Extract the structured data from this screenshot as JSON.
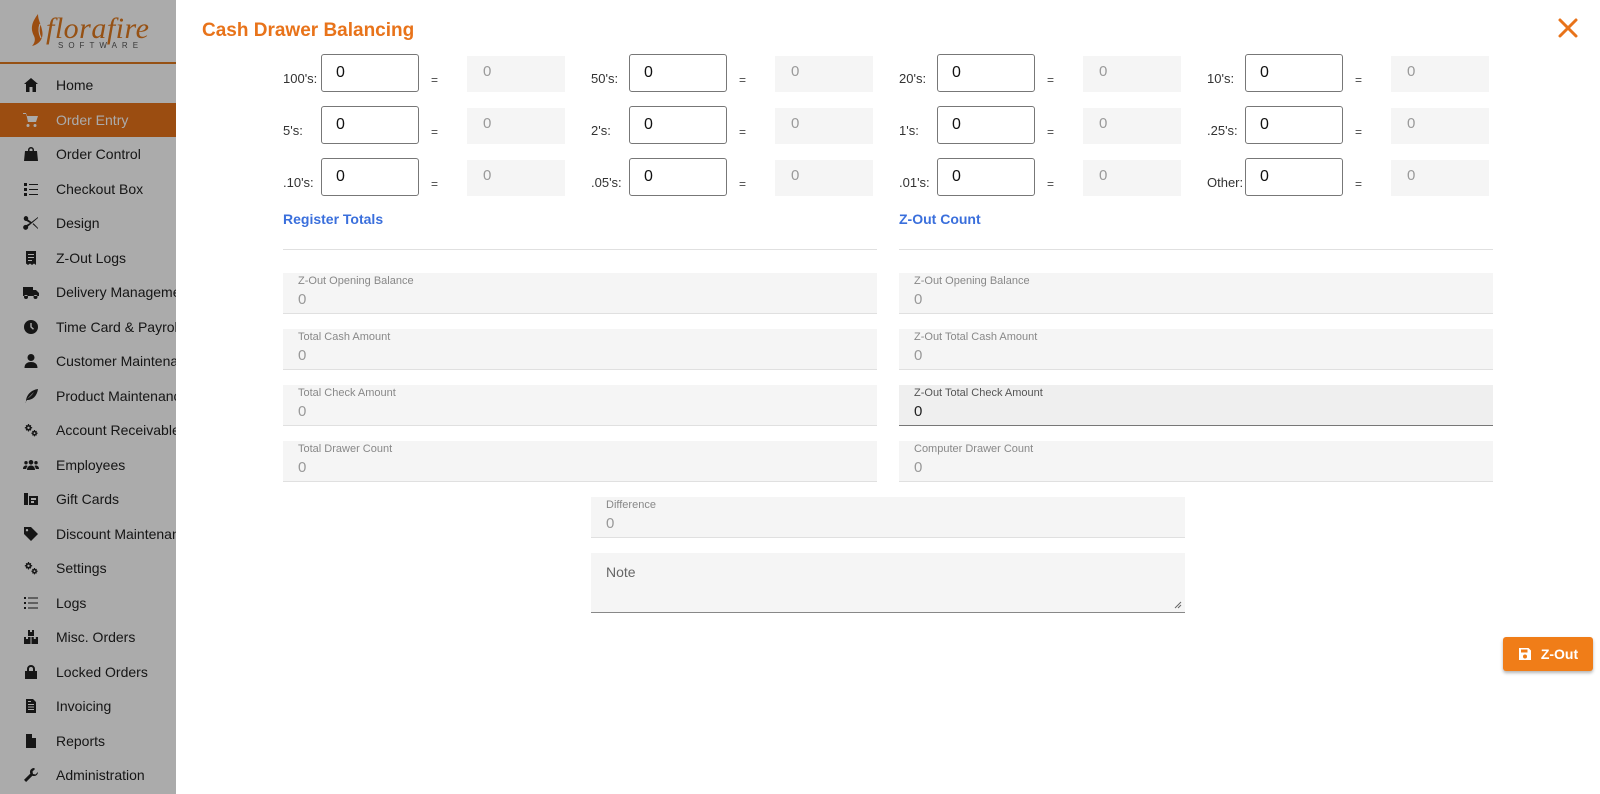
{
  "app": {
    "logo_text": "florafire",
    "logo_sub": "SOFTWARE",
    "brand_color": "#e8731a"
  },
  "sidebar": {
    "items": [
      {
        "label": "Home",
        "icon": "home-icon"
      },
      {
        "label": "Order Entry",
        "icon": "cart-icon",
        "active": true
      },
      {
        "label": "Order Control",
        "icon": "bag-icon"
      },
      {
        "label": "Checkout Box",
        "icon": "checklist-icon"
      },
      {
        "label": "Design",
        "icon": "scissors-icon"
      },
      {
        "label": "Z-Out Logs",
        "icon": "receipt-icon"
      },
      {
        "label": "Delivery Management",
        "icon": "truck-icon"
      },
      {
        "label": "Time Card & Payroll",
        "icon": "clock-icon"
      },
      {
        "label": "Customer Maintenance",
        "icon": "user-icon"
      },
      {
        "label": "Product Maintenance",
        "icon": "leaf-icon"
      },
      {
        "label": "Account Receivable",
        "icon": "gears-icon"
      },
      {
        "label": "Employees",
        "icon": "users-icon"
      },
      {
        "label": "Gift Cards",
        "icon": "gift-card-icon"
      },
      {
        "label": "Discount Maintenance",
        "icon": "tag-icon"
      },
      {
        "label": "Settings",
        "icon": "gears-icon"
      },
      {
        "label": "Logs",
        "icon": "list-icon"
      },
      {
        "label": "Misc. Orders",
        "icon": "boxes-icon"
      },
      {
        "label": "Locked Orders",
        "icon": "lock-icon"
      },
      {
        "label": "Invoicing",
        "icon": "invoice-icon"
      },
      {
        "label": "Reports",
        "icon": "file-icon"
      },
      {
        "label": "Administration",
        "icon": "wrench-icon"
      }
    ]
  },
  "modal": {
    "title": "Cash Drawer Balancing",
    "denominations": [
      {
        "label": "100's:",
        "value": "0",
        "result": "0"
      },
      {
        "label": "50's:",
        "value": "0",
        "result": "0"
      },
      {
        "label": "20's:",
        "value": "0",
        "result": "0"
      },
      {
        "label": "10's:",
        "value": "0",
        "result": "0"
      },
      {
        "label": "5's:",
        "value": "0",
        "result": "0"
      },
      {
        "label": "2's:",
        "value": "0",
        "result": "0"
      },
      {
        "label": "1's:",
        "value": "0",
        "result": "0"
      },
      {
        "label": ".25's:",
        "value": "0",
        "result": "0"
      },
      {
        "label": ".10's:",
        "value": "0",
        "result": "0"
      },
      {
        "label": ".05's:",
        "value": "0",
        "result": "0"
      },
      {
        "label": ".01's:",
        "value": "0",
        "result": "0"
      },
      {
        "label": "Other:",
        "value": "0",
        "result": "0"
      }
    ],
    "equals": "=",
    "register_totals": {
      "title": "Register Totals",
      "fields": [
        {
          "label": "Z-Out Opening Balance",
          "value": "0"
        },
        {
          "label": "Total Cash Amount",
          "value": "0"
        },
        {
          "label": "Total Check Amount",
          "value": "0"
        },
        {
          "label": "Total Drawer Count",
          "value": "0"
        }
      ]
    },
    "zout_count": {
      "title": "Z-Out Count",
      "fields": [
        {
          "label": "Z-Out Opening Balance",
          "value": "0"
        },
        {
          "label": "Z-Out Total Cash Amount",
          "value": "0"
        },
        {
          "label": "Z-Out Total Check Amount",
          "value": "0"
        },
        {
          "label": "Computer Drawer Count",
          "value": "0"
        }
      ]
    },
    "difference": {
      "label": "Difference",
      "value": "0"
    },
    "note": {
      "label": "Note"
    },
    "zout_button": "Z-Out"
  }
}
